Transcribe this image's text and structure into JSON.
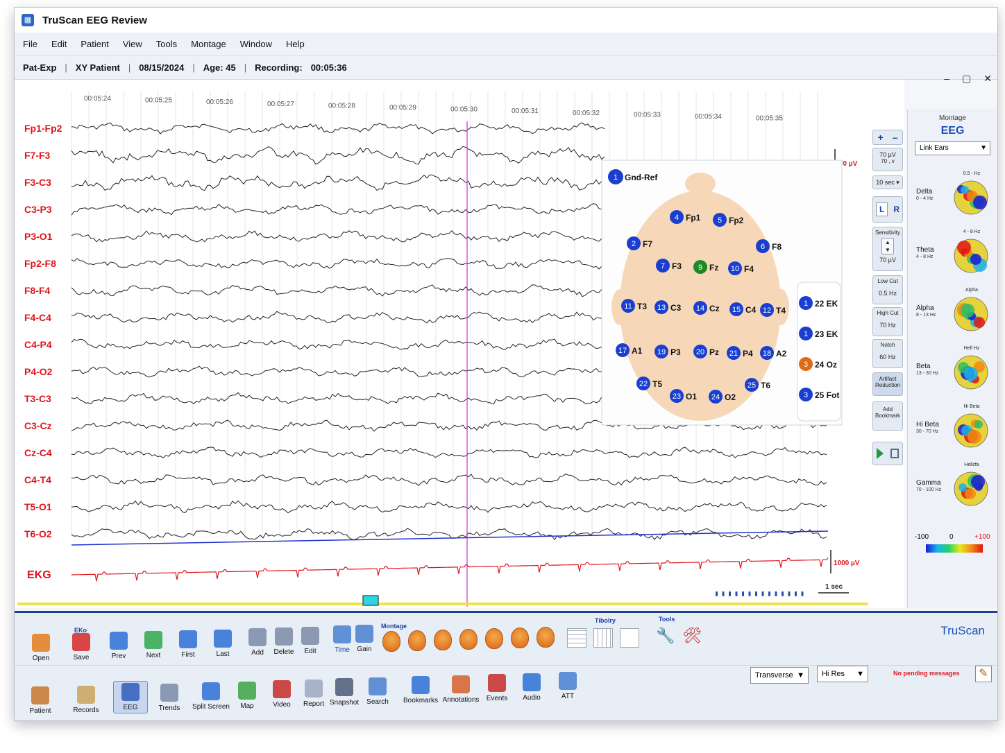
{
  "app": {
    "title": "TruScan EEG Review",
    "brand": "TruScan"
  },
  "menu": [
    "File",
    "Edit",
    "Patient",
    "View",
    "Tools",
    "Montage",
    "Window",
    "Help"
  ],
  "patient_bar": {
    "exp": "Pat-Exp",
    "name": "XY Patient",
    "date": "08/15/2024",
    "age": "Age: 45",
    "recording_label": "Recording:",
    "recording_time": "00:05:36"
  },
  "window_controls": {
    "minimize": "–",
    "maximize": "▢",
    "close": "✕"
  },
  "timeline": [
    "00:05:24",
    "00:05:25",
    "00:05:26",
    "00:05:27",
    "00:05:28",
    "00:05:29",
    "00:05:30",
    "00:05:31",
    "00:05:32",
    "00:05:33",
    "00:05:34",
    "00:05:35"
  ],
  "channels": [
    "Fp1-Fp2",
    "F7-F3",
    "F3-C3",
    "C3-P3",
    "P3-O1",
    "Fp2-F8",
    "F8-F4",
    "F4-C4",
    "C4-P4",
    "P4-O2",
    "T3-C3",
    "C3-Cz",
    "Cz-C4",
    "C4-T4",
    "T5-O1",
    "T6-O2"
  ],
  "ekg_label": "EKG",
  "scales": {
    "eeg": "70 µV",
    "ekg": "1000 µV",
    "time": "1 sec"
  },
  "head_map": {
    "ground": {
      "num": "1",
      "label": "Gnd-Ref"
    },
    "electrodes": [
      {
        "num": "4",
        "label": "Fp1",
        "color": "#1a3fd0"
      },
      {
        "num": "5",
        "label": "Fp2",
        "color": "#1a3fd0"
      },
      {
        "num": "2",
        "label": "F7",
        "color": "#1a3fd0"
      },
      {
        "num": "6",
        "label": "F8",
        "color": "#1a3fd0"
      },
      {
        "num": "7",
        "label": "F3",
        "color": "#1a3fd0"
      },
      {
        "num": "9",
        "label": "Fz",
        "color": "#1d8a23"
      },
      {
        "num": "10",
        "label": "F4",
        "color": "#1a3fd0"
      },
      {
        "num": "11",
        "label": "T3",
        "color": "#1a3fd0"
      },
      {
        "num": "13",
        "label": "C3",
        "color": "#1a3fd0"
      },
      {
        "num": "14",
        "label": "Cz",
        "color": "#1a3fd0"
      },
      {
        "num": "15",
        "label": "C4",
        "color": "#1a3fd0"
      },
      {
        "num": "12",
        "label": "T4",
        "color": "#1a3fd0"
      },
      {
        "num": "17",
        "label": "A1",
        "color": "#1a3fd0"
      },
      {
        "num": "19",
        "label": "P3",
        "color": "#1a3fd0"
      },
      {
        "num": "20",
        "label": "Pz",
        "color": "#1a3fd0"
      },
      {
        "num": "21",
        "label": "P4",
        "color": "#1a3fd0"
      },
      {
        "num": "18",
        "label": "A2",
        "color": "#1a3fd0"
      },
      {
        "num": "22",
        "label": "T5",
        "color": "#1a3fd0"
      },
      {
        "num": "25",
        "label": "T6",
        "color": "#1a3fd0"
      },
      {
        "num": "23",
        "label": "O1",
        "color": "#1a3fd0"
      },
      {
        "num": "24",
        "label": "O2",
        "color": "#1a3fd0"
      }
    ],
    "aux": [
      {
        "num": "1",
        "label": "22 EK",
        "color": "#1a3fd0"
      },
      {
        "num": "1",
        "label": "23 EK",
        "color": "#1a3fd0"
      },
      {
        "num": "3",
        "label": "24 Oz",
        "color": "#e06a12"
      },
      {
        "num": "3",
        "label": "25 Fot",
        "color": "#1a3fd0"
      }
    ]
  },
  "controls": {
    "plus": "+",
    "minus": "–",
    "sens_top": "70 µV",
    "sens_sub": "70 , v",
    "timebase": "10 sec",
    "left": "L",
    "right": "R",
    "sensitivity_label": "Sensitivity",
    "sensitivity_value": "70 µV",
    "lowcut_label": "Low Cut",
    "lowcut_value": "0.5 Hz",
    "highcut_label": "High Cut",
    "highcut_value": "70 Hz",
    "notch_label": "Notch",
    "notch_value": "60 Hz",
    "artifact": "Artifact Reduction",
    "bookmark": "Add Bookmark"
  },
  "right_panel": {
    "montage_label": "Montage",
    "eeg_label": "EEG",
    "reference": "Link Ears",
    "bands": [
      {
        "name": "Delta",
        "range": "0 - 4 Hz",
        "top": "0.5 - Hz"
      },
      {
        "name": "Theta",
        "range": "4 - 8 Hz",
        "top": "4 - 8 Hz"
      },
      {
        "name": "Alpha",
        "range": "8 - 13 Hz",
        "top": "Alpha"
      },
      {
        "name": "Beta",
        "range": "13 - 30 Hz",
        "top": "Hell Hz"
      },
      {
        "name": "Hi Beta",
        "range": "30 - 70 Hz",
        "top": "Hi Beta"
      },
      {
        "name": "Gamma",
        "range": "70 - 100 Hz",
        "top": "Hellcfa"
      }
    ],
    "scale": {
      "min": "-100",
      "mid": "0",
      "max": "+100"
    }
  },
  "toolbar1": {
    "eko_label": "EKo",
    "montage_label": "Montage",
    "tibolry_label": "Tibolry",
    "tools_label": "Tools",
    "buttons": [
      "Open",
      "Save",
      "Prev",
      "Next",
      "First",
      "Last",
      "Add",
      "Delete",
      "Edit",
      "Time",
      "Gain"
    ]
  },
  "toolbar2": {
    "buttons": [
      "Patient",
      "Records",
      "EEG",
      "Trends",
      "Split Screen",
      "Map",
      "Video",
      "Report",
      "Snapshot",
      "Search",
      "Bookmarks",
      "Annotations",
      "Events",
      "Audio",
      "ATT"
    ],
    "select1": "Transverse",
    "select2": "Hi Res",
    "status": "No pending messages"
  },
  "colors": {
    "channel_label": "#e0141e",
    "ekg": "#e0141e",
    "cursor": "#d42bd4",
    "accent": "#1b3f9f"
  }
}
